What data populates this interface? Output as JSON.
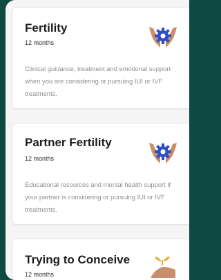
{
  "cards": [
    {
      "title": "Fertility",
      "duration": "12 months",
      "description": "Clinical guidance, treatment and emotional support when you are considering or pursuing IUI or IVF treatments.",
      "icon": "hands-gear-icon"
    },
    {
      "title": "Partner Fertility",
      "duration": "12 months",
      "description": "Educational resources and mental health support if your partner is considering or pursuing IUI or IVF treatments.",
      "icon": "hands-gear-icon"
    },
    {
      "title": "Trying to Conceive",
      "duration": "12 months",
      "description": "",
      "icon": "hand-seedling-icon"
    }
  ],
  "colors": {
    "background": "#0f4a42",
    "panel": "#f4f5f4",
    "card": "#ffffff",
    "skin": "#c98e6b",
    "gear": "#2e4fc4",
    "leaf": "#e8b23a"
  }
}
